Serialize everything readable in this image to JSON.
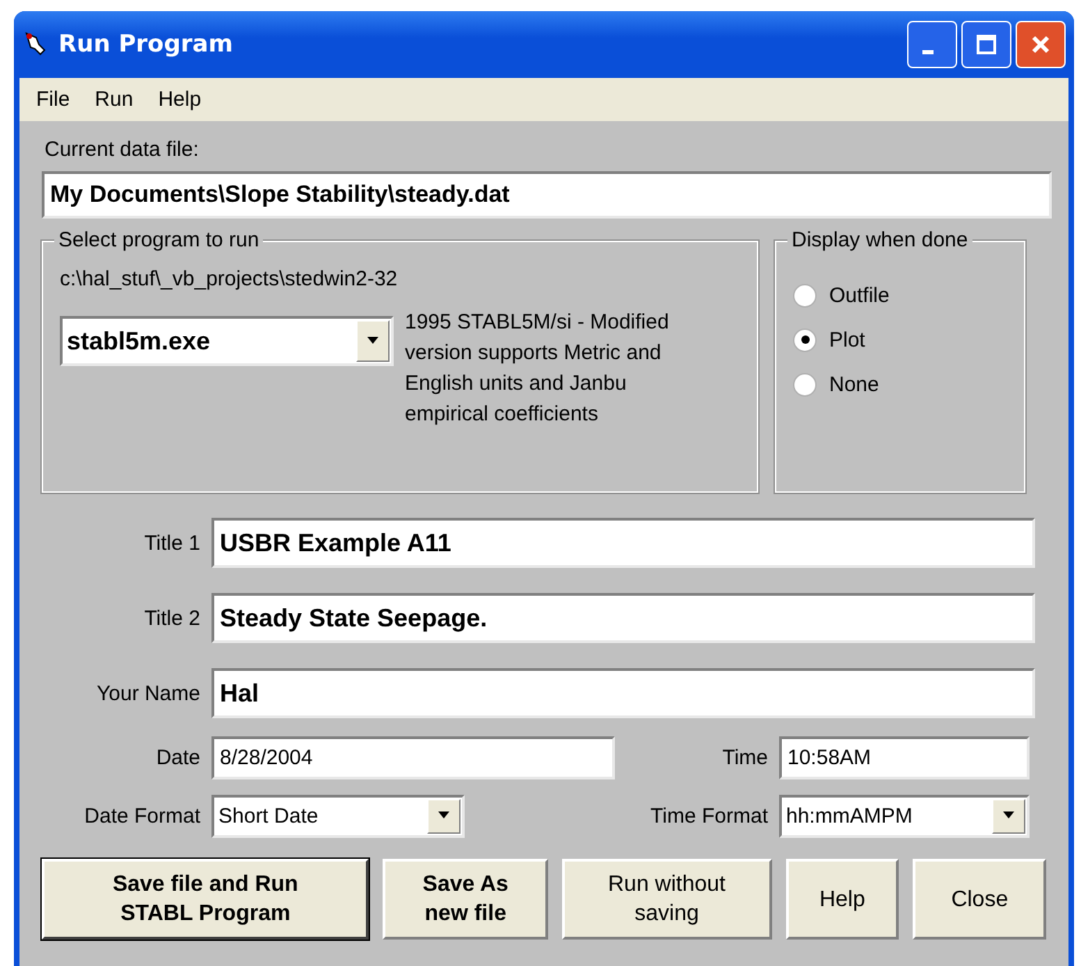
{
  "window": {
    "title": "Run Program"
  },
  "menu": [
    {
      "label": "File"
    },
    {
      "label": "Run"
    },
    {
      "label": "Help"
    }
  ],
  "current_file": {
    "label": "Current data file:",
    "value": "My Documents\\Slope Stability\\steady.dat"
  },
  "program_group": {
    "title": "Select program to run",
    "path": "c:\\hal_stuf\\_vb_projects\\stedwin2-32",
    "program": "stabl5m.exe",
    "description": "1995 STABL5M/si - Modified version supports Metric and English units and Janbu empirical coefficients"
  },
  "display_group": {
    "title": "Display when done",
    "options": [
      {
        "label": "Outfile",
        "selected": false
      },
      {
        "label": "Plot",
        "selected": true
      },
      {
        "label": "None",
        "selected": false
      }
    ]
  },
  "text_fields": [
    {
      "label": "Title 1",
      "value": "USBR Example A11"
    },
    {
      "label": "Title 2",
      "value": "Steady State Seepage."
    },
    {
      "label": "Your Name",
      "value": "Hal"
    }
  ],
  "date": {
    "label": "Date",
    "value": "8/28/2004"
  },
  "time": {
    "label": "Time",
    "value": "10:58AM"
  },
  "date_format": {
    "label": "Date Format",
    "value": "Short Date"
  },
  "time_format": {
    "label": "Time Format",
    "value": "hh:mmAMPM"
  },
  "buttons": [
    {
      "label": "Save file and Run\nSTABL Program",
      "bold": true,
      "default": true
    },
    {
      "label": "Save As\nnew file",
      "bold": true,
      "default": false
    },
    {
      "label": "Run without\nsaving",
      "bold": false,
      "default": false
    },
    {
      "label": "Help",
      "bold": false,
      "default": false
    },
    {
      "label": "Close",
      "bold": false,
      "default": false
    }
  ]
}
